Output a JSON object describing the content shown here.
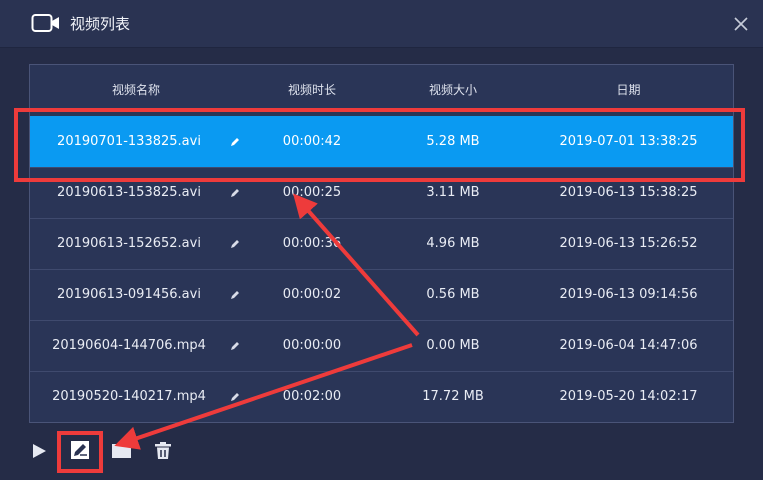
{
  "window": {
    "title": "视频列表",
    "title_icon": "video-camera-icon",
    "close_icon": "close-icon"
  },
  "table": {
    "headers": {
      "name": "视频名称",
      "duration": "视频时长",
      "size": "视频大小",
      "date": "日期"
    },
    "rows": [
      {
        "name": "20190701-133825.avi",
        "duration": "00:00:42",
        "size": "5.28 MB",
        "date": "2019-07-01 13:38:25",
        "selected": true
      },
      {
        "name": "20190613-153825.avi",
        "duration": "00:00:25",
        "size": "3.11 MB",
        "date": "2019-06-13 15:38:25",
        "selected": false
      },
      {
        "name": "20190613-152652.avi",
        "duration": "00:00:36",
        "size": "4.96 MB",
        "date": "2019-06-13 15:26:52",
        "selected": false
      },
      {
        "name": "20190613-091456.avi",
        "duration": "00:00:02",
        "size": "0.56 MB",
        "date": "2019-06-13 09:14:56",
        "selected": false
      },
      {
        "name": "20190604-144706.mp4",
        "duration": "00:00:00",
        "size": "0.00 MB",
        "date": "2019-06-04 14:47:06",
        "selected": false
      },
      {
        "name": "20190520-140217.mp4",
        "duration": "00:02:00",
        "size": "17.72 MB",
        "date": "2019-05-20 14:02:17",
        "selected": false
      }
    ]
  },
  "toolbar": {
    "items": [
      "play-icon",
      "edit-icon",
      "folder-icon",
      "trash-icon"
    ]
  },
  "colors": {
    "background": "#272f4c",
    "table_bg": "#2a3557",
    "selected_row": "#0a9af2",
    "annotation_red": "#ee3b3b"
  }
}
